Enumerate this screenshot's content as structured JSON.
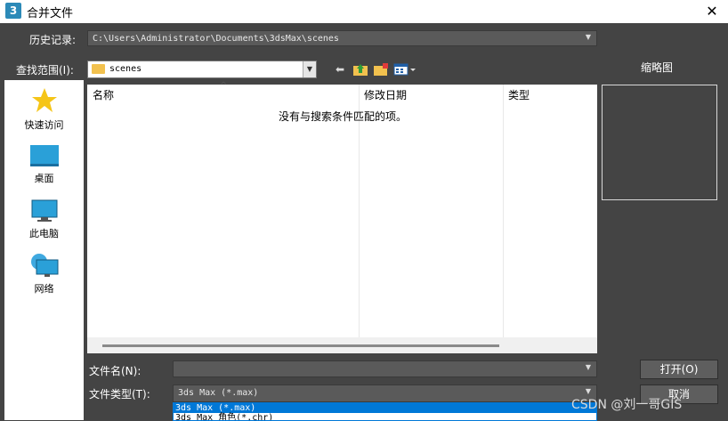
{
  "window": {
    "title": "合并文件",
    "app_icon_text": "3",
    "close_glyph": "✕"
  },
  "history": {
    "label": "历史记录:",
    "value": "C:\\Users\\Administrator\\Documents\\3dsMax\\scenes"
  },
  "look_in": {
    "label": "查找范围(I):",
    "value": "scenes"
  },
  "places": [
    {
      "label": "快速访问",
      "icon": "star-icon"
    },
    {
      "label": "桌面",
      "icon": "desktop-icon"
    },
    {
      "label": "此电脑",
      "icon": "computer-icon"
    },
    {
      "label": "网络",
      "icon": "network-icon"
    }
  ],
  "file_list": {
    "columns": [
      "名称",
      "修改日期",
      "类型"
    ],
    "empty_message": "没有与搜索条件匹配的项。"
  },
  "thumbnail": {
    "label": "缩略图"
  },
  "file_name": {
    "label": "文件名(N):",
    "value": ""
  },
  "file_type": {
    "label": "文件类型(T):",
    "value": "3ds Max (*.max)",
    "options": [
      "3ds Max (*.max)",
      "3ds Max 角色(*.chr)"
    ]
  },
  "buttons": {
    "open": "打开(O)",
    "cancel": "取消"
  },
  "watermark": "CSDN @刘一哥GIS",
  "colors": {
    "background": "#444444",
    "selection": "#0078d7",
    "folder": "#f2c14e"
  }
}
